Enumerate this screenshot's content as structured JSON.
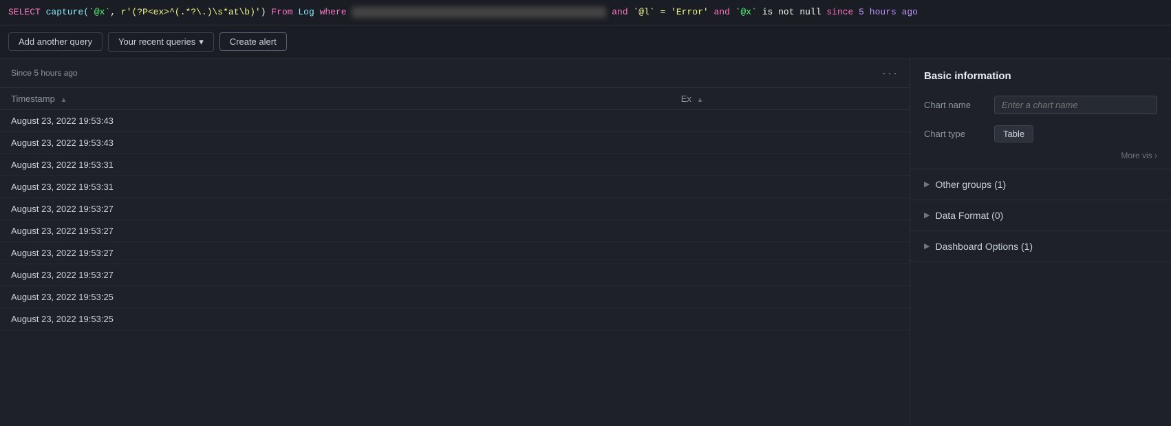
{
  "query": {
    "select": "SELECT",
    "func": "capture(",
    "backtick_x": "`@x`",
    "comma": ", ",
    "regex": "r'(?P<ex>^(.*?\\.)\\s*at\\b)'",
    "pipe": ")",
    "from": "From",
    "log": "Log",
    "where": "where",
    "blurred_text": "redacted.app.node.service.name",
    "and1": "and",
    "condition1": "`@l` = 'Error'",
    "and2": "and",
    "condition2": "`@x` is not null",
    "since": "since",
    "time": "5 hours ago"
  },
  "toolbar": {
    "add_query_label": "Add another query",
    "recent_queries_label": "Your recent queries",
    "chevron_down": "▾",
    "create_alert_label": "Create alert"
  },
  "table_area": {
    "time_label": "Since 5 hours ago",
    "columns": [
      {
        "key": "timestamp",
        "label": "Timestamp",
        "sortable": true
      },
      {
        "key": "ex",
        "label": "Ex",
        "sortable": true
      }
    ],
    "rows": [
      {
        "timestamp": "August 23, 2022 19:53:43",
        "ex": ""
      },
      {
        "timestamp": "August 23, 2022 19:53:43",
        "ex": ""
      },
      {
        "timestamp": "August 23, 2022 19:53:31",
        "ex": ""
      },
      {
        "timestamp": "August 23, 2022 19:53:31",
        "ex": ""
      },
      {
        "timestamp": "August 23, 2022 19:53:27",
        "ex": ""
      },
      {
        "timestamp": "August 23, 2022 19:53:27",
        "ex": ""
      },
      {
        "timestamp": "August 23, 2022 19:53:27",
        "ex": ""
      },
      {
        "timestamp": "August 23, 2022 19:53:27",
        "ex": ""
      },
      {
        "timestamp": "August 23, 2022 19:53:25",
        "ex": ""
      },
      {
        "timestamp": "August 23, 2022 19:53:25",
        "ex": ""
      }
    ]
  },
  "right_panel": {
    "basic_info_title": "Basic information",
    "chart_name_label": "Chart name",
    "chart_name_placeholder": "Enter a chart name",
    "chart_type_label": "Chart type",
    "chart_type_value": "Table",
    "more_vis_label": "More vis",
    "other_groups_label": "Other groups (1)",
    "data_format_label": "Data Format (0)",
    "dashboard_options_label": "Dashboard Options (1)"
  },
  "colors": {
    "keyword": "#ff79c6",
    "function": "#8be9fd",
    "string_val": "#f1fa8c",
    "param": "#50fa7b",
    "number": "#bd93f9",
    "plain": "#f8f8f2"
  }
}
